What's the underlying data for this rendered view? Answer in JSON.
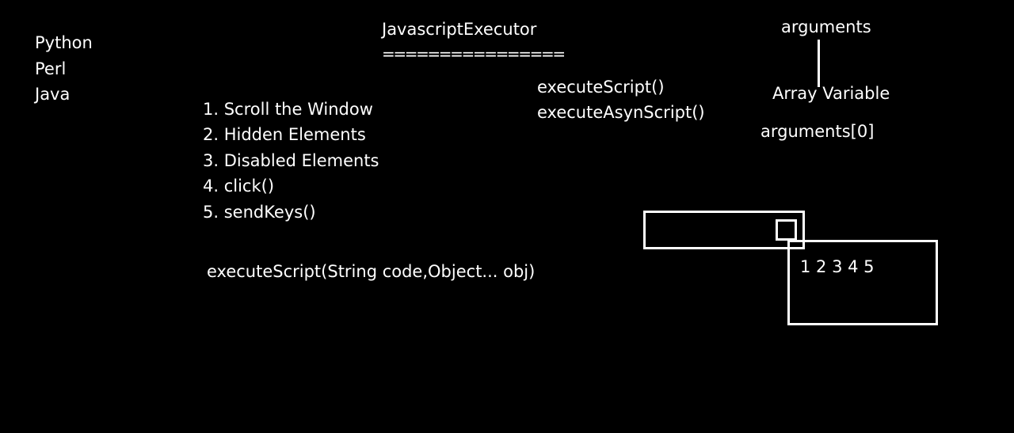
{
  "languages": [
    "Python",
    "Perl",
    "Java"
  ],
  "header": {
    "title": "JavascriptExecutor",
    "underline": "================"
  },
  "uses": [
    "1. Scroll the Window",
    "2. Hidden Elements",
    "3. Disabled Elements",
    "4. click()",
    "5. sendKeys()"
  ],
  "signature": "executeScript(String code,Object... obj)",
  "methods": [
    "executeScript()",
    "executeAsynScript()"
  ],
  "arguments": {
    "label": "arguments",
    "description": "Array Variable",
    "index_example": "arguments[0]"
  },
  "diagram": {
    "values_label": "1 2 3 4 5"
  },
  "colors": {
    "background": "#000000",
    "foreground": "#ffffff"
  }
}
